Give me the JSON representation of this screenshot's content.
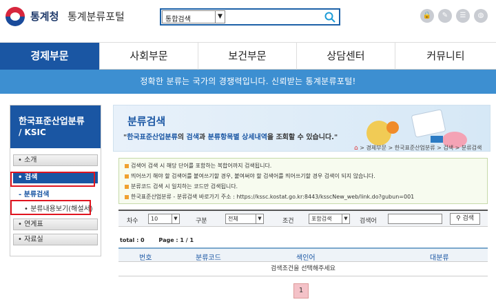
{
  "header": {
    "brand_primary": "통계청",
    "brand_secondary": "통계분류포털",
    "search_scope": "통합검색",
    "search_value": "",
    "icons": [
      "lock-icon",
      "edit-icon",
      "list-icon",
      "globe-icon"
    ]
  },
  "nav": {
    "items": [
      {
        "label": "경제부문",
        "active": true
      },
      {
        "label": "사회부문",
        "active": false
      },
      {
        "label": "보건부문",
        "active": false
      },
      {
        "label": "상담센터",
        "active": false
      },
      {
        "label": "커뮤니티",
        "active": false
      }
    ]
  },
  "banner": {
    "text": "정확한 분류는 국가의 경쟁력입니다. 신뢰받는 통계분류포털!"
  },
  "sidebar": {
    "title": "한국표준산업분류",
    "subtitle": "/ KSIC",
    "menu": [
      {
        "label": "소개"
      },
      {
        "label": "검색"
      },
      {
        "label": "연계표"
      },
      {
        "label": "자료실"
      }
    ],
    "sub_active": "분류검색",
    "sub_item": "분류내용보기(해설서)"
  },
  "hero": {
    "title": "분류검색",
    "desc_open": "\"",
    "desc_em1": "한국표준산업분류",
    "desc_mid1": "의 ",
    "desc_em2": "검색",
    "desc_mid2": "과 ",
    "desc_em3": "분류항목별 상세내역",
    "desc_tail": "을 조회할 수 있습니다.\"",
    "breadcrumb": "> 경제부문 > 한국표준산업분류 > 검색 > 분류검색"
  },
  "info": [
    "검색어 검색 시 해당 단어를 포함하는 복합어까지 검색됩니다.",
    "띄어쓰기 해야 할 검색어를 붙여쓰기할 경우, 붙여써야 할 검색어를 띄어쓰기할 경우 검색이 되지 않습니다.",
    "분류코드 검색 시 일치하는 코드만 검색됩니다.",
    "한국표준산업분류 - 분류검색 바로가기 주소 : https://kssc.kostat.go.kr:8443/ksscNew_web/link.do?gubun=001"
  ],
  "filter": {
    "level_label": "차수",
    "level_value": "10",
    "type_label": "구분",
    "type_value": "전체",
    "cond_label": "조건",
    "cond_value": "포함검색",
    "keyword_label": "검색어",
    "keyword_value": "",
    "search_button": "검색"
  },
  "results": {
    "total": "total : 0",
    "page": "Page : 1 / 1",
    "columns": [
      "번호",
      "분류코드",
      "색인어",
      "대분류"
    ],
    "empty": "검색조건을 선택해주세요",
    "pages": [
      "1"
    ]
  }
}
